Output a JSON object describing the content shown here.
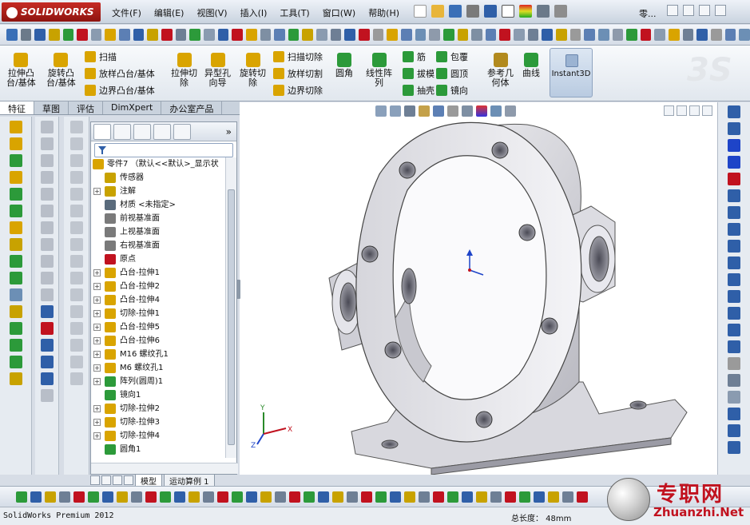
{
  "app": {
    "brand": "SOLIDWORKS",
    "menu": [
      "文件(F)",
      "编辑(E)",
      "视图(V)",
      "插入(I)",
      "工具(T)",
      "窗口(W)",
      "帮助(H)"
    ],
    "right_menu": "零..."
  },
  "ribbon": {
    "large": [
      {
        "label": "拉伸凸\n台/基体",
        "color": "#d9a400"
      },
      {
        "label": "旋转凸\n台/基体",
        "color": "#d9a400"
      },
      {
        "label": "拉伸切\n除",
        "color": "#d9a400"
      },
      {
        "label": "异型孔\n向导",
        "color": "#d9a400"
      },
      {
        "label": "旋转切\n除",
        "color": "#d9a400"
      },
      {
        "label": "圆角",
        "color": "#2c9a3a"
      },
      {
        "label": "线性阵\n列",
        "color": "#2c9a3a"
      },
      {
        "label": "参考几\n何体",
        "color": "#b28a1e"
      },
      {
        "label": "曲线",
        "color": "#2c9a3a"
      }
    ],
    "small": [
      {
        "label": "扫描",
        "color": "#d9a400"
      },
      {
        "label": "放样凸台/基体",
        "color": "#d9a400"
      },
      {
        "label": "边界凸台/基体",
        "color": "#d9a400"
      },
      {
        "label": "扫描切除",
        "color": "#d9a400"
      },
      {
        "label": "放样切割",
        "color": "#d9a400"
      },
      {
        "label": "边界切除",
        "color": "#d9a400"
      },
      {
        "label": "筋",
        "color": "#2c9a3a"
      },
      {
        "label": "拔模",
        "color": "#2c9a3a"
      },
      {
        "label": "抽壳",
        "color": "#2c9a3a"
      },
      {
        "label": "包覆",
        "color": "#2c9a3a"
      },
      {
        "label": "圆顶",
        "color": "#2c9a3a"
      },
      {
        "label": "镜向",
        "color": "#2c9a3a"
      }
    ],
    "instant3d": "Instant3D"
  },
  "command_tabs": [
    "特征",
    "草图",
    "评估",
    "DimXpert",
    "办公室产品"
  ],
  "feature_tree": {
    "root": "零件7 （默认<<默认>_显示状",
    "items": [
      {
        "label": "传感器",
        "exp": "",
        "color": "#c8a200"
      },
      {
        "label": "注解",
        "exp": "+",
        "color": "#c8a200"
      },
      {
        "label": "材质 <未指定>",
        "exp": "",
        "color": "#5a6b7c"
      },
      {
        "label": "前视基准面",
        "exp": "",
        "color": "#7a7a7a"
      },
      {
        "label": "上视基准面",
        "exp": "",
        "color": "#7a7a7a"
      },
      {
        "label": "右视基准面",
        "exp": "",
        "color": "#7a7a7a"
      },
      {
        "label": "原点",
        "exp": "",
        "color": "#c1121f"
      },
      {
        "label": "凸台-拉伸1",
        "exp": "+",
        "color": "#d9a400"
      },
      {
        "label": "凸台-拉伸2",
        "exp": "+",
        "color": "#d9a400"
      },
      {
        "label": "凸台-拉伸4",
        "exp": "+",
        "color": "#d9a400"
      },
      {
        "label": "切除-拉伸1",
        "exp": "+",
        "color": "#d9a400"
      },
      {
        "label": "凸台-拉伸5",
        "exp": "+",
        "color": "#d9a400"
      },
      {
        "label": "凸台-拉伸6",
        "exp": "+",
        "color": "#d9a400"
      },
      {
        "label": "M16 螺纹孔1",
        "exp": "+",
        "color": "#d9a400"
      },
      {
        "label": "M6 螺纹孔1",
        "exp": "+",
        "color": "#d9a400"
      },
      {
        "label": "阵列(圆周)1",
        "exp": "+",
        "color": "#2c9a3a"
      },
      {
        "label": "镜向1",
        "exp": "",
        "color": "#2c9a3a"
      },
      {
        "label": "切除-拉伸2",
        "exp": "+",
        "color": "#d9a400"
      },
      {
        "label": "切除-拉伸3",
        "exp": "+",
        "color": "#d9a400"
      },
      {
        "label": "切除-拉伸4",
        "exp": "+",
        "color": "#d9a400"
      },
      {
        "label": "圆角1",
        "exp": "",
        "color": "#2c9a3a"
      }
    ]
  },
  "bottom_tabs": [
    "模型",
    "运动算例 1"
  ],
  "status": {
    "product": "SolidWorks Premium 2012",
    "length": "总长度： 48mm"
  },
  "watermark": {
    "cn": "专职网",
    "url": "Zhuanzhi.Net"
  },
  "colors": {
    "accent": "#2f5fa8",
    "part_face": "#e7e7ec",
    "brand_red": "#c1121f"
  }
}
